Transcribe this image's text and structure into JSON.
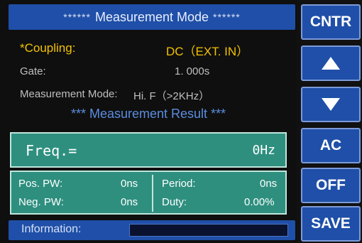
{
  "title": {
    "prefix_stars": "******",
    "text": "Measurement Mode",
    "suffix_stars": "******"
  },
  "params": {
    "coupling": {
      "label": "*Coupling:",
      "value": "DC（EXT. IN）"
    },
    "gate": {
      "label": "Gate:",
      "value": "1. 000s"
    },
    "mode": {
      "label": "Measurement Mode:",
      "value": "Hi. F（>2KHz）"
    }
  },
  "result": {
    "title": "*** Measurement Result ***",
    "freq": {
      "label": "Freq.=",
      "value": "0Hz"
    },
    "pos_pw": {
      "label": "Pos. PW:",
      "value": "0ns"
    },
    "neg_pw": {
      "label": "Neg. PW:",
      "value": "0ns"
    },
    "period": {
      "label": "Period:",
      "value": "0ns"
    },
    "duty": {
      "label": "Duty:",
      "value": "0.00%"
    }
  },
  "info": {
    "label": "Information:"
  },
  "softkeys": {
    "k1": "CNTR",
    "k2_icon": "up-arrow-icon",
    "k3_icon": "down-arrow-icon",
    "k4": "AC",
    "k5": "OFF",
    "k6": "SAVE"
  },
  "colors": {
    "title_bar": "#1f4fa8",
    "highlight": "#f2c200",
    "result_panel": "#2e8f7f",
    "result_title": "#5b8de0"
  }
}
